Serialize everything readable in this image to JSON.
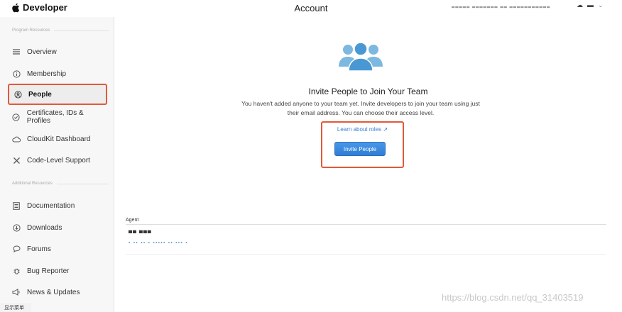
{
  "topbar": {
    "brand": "Developer",
    "title": "Account",
    "account_info": "▀▀▀▀▀ ▀▀▀▀▀▀▀ ▀▀ ▀▀▀▀▀▀▀▀▀▀▀",
    "user_control": "☁",
    "user_control_2": "▬",
    "chevron": "⌄"
  },
  "sidebar": {
    "section_program": "Program Resources",
    "section_additional": "Additional Resources",
    "items": [
      {
        "label": "Overview"
      },
      {
        "label": "Membership"
      },
      {
        "label": "People"
      },
      {
        "label": "Certificates, IDs & Profiles"
      },
      {
        "label": "CloudKit Dashboard"
      },
      {
        "label": "Code-Level Support"
      },
      {
        "label": "Documentation"
      },
      {
        "label": "Downloads"
      },
      {
        "label": "Forums"
      },
      {
        "label": "Bug Reporter"
      },
      {
        "label": "News & Updates"
      }
    ]
  },
  "main": {
    "title": "Invite People to Join Your Team",
    "description": "You haven't added anyone to your team yet. Invite developers to join your team using just their email address. You can choose their access level.",
    "learn_link": "Learn about roles ↗",
    "invite_button": "Invite People"
  },
  "agent": {
    "header": "Agent",
    "name": "▀▀ ▀▀▀",
    "email": "▪ ▪▪ ▪▪ ▪ ▪▪▪▪▪ ▪▪ ▪▪▪ ▪"
  },
  "footer_label": "显示菜单",
  "watermark": "https://blog.csdn.net/qq_31403519"
}
